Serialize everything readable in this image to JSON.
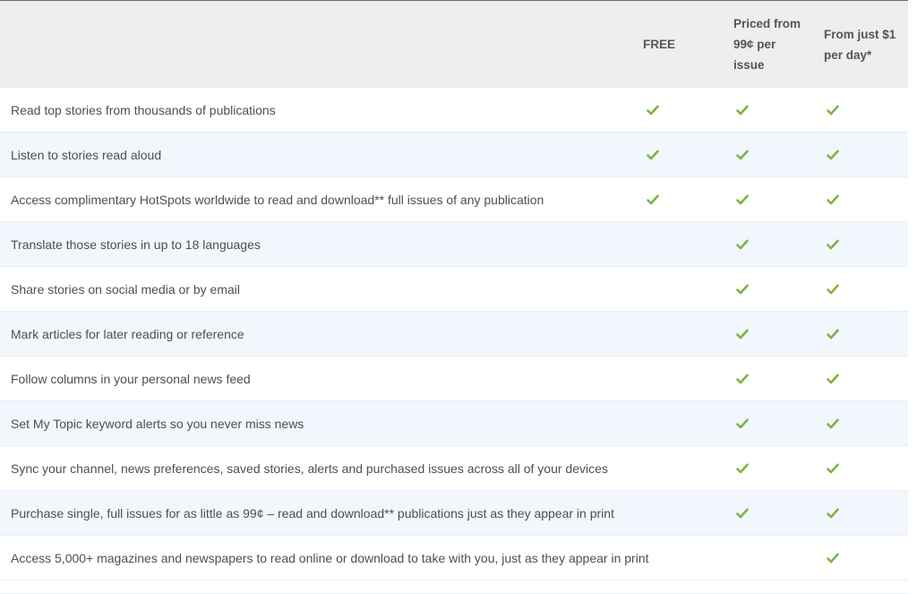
{
  "header": {
    "col_free": [
      "FREE"
    ],
    "col_priced": [
      "Priced from",
      "99¢ per",
      "issue"
    ],
    "col_day": [
      "From just $1",
      "per day*"
    ]
  },
  "colors": {
    "check": "#7cb342",
    "header_bg": "#eeeeee",
    "row_alt_bg": "#f1f7fc"
  },
  "rows": [
    {
      "feature": "Read top stories from thousands of publications",
      "free": true,
      "priced": true,
      "day": true
    },
    {
      "feature": "Listen to stories read aloud",
      "free": true,
      "priced": true,
      "day": true
    },
    {
      "feature": "Access complimentary HotSpots worldwide to read and download** full issues of any publication",
      "free": true,
      "priced": true,
      "day": true
    },
    {
      "feature": "Translate those stories in up to 18 languages",
      "free": false,
      "priced": true,
      "day": true
    },
    {
      "feature": "Share stories on social media or by email",
      "free": false,
      "priced": true,
      "day": true
    },
    {
      "feature": "Mark articles for later reading or reference",
      "free": false,
      "priced": true,
      "day": true
    },
    {
      "feature": "Follow columns in your personal news feed",
      "free": false,
      "priced": true,
      "day": true
    },
    {
      "feature": "Set My Topic keyword alerts so you never miss news",
      "free": false,
      "priced": true,
      "day": true
    },
    {
      "feature": "Sync your channel, news preferences, saved stories, alerts and purchased issues across all of your devices",
      "free": false,
      "priced": true,
      "day": true
    },
    {
      "feature": "Purchase single, full issues for as little as 99¢ – read and download** publications just as they appear in print",
      "free": false,
      "priced": true,
      "day": true
    },
    {
      "feature": "Access 5,000+ magazines and newspapers to read online or download to take with you, just as they appear in print",
      "free": false,
      "priced": false,
      "day": true
    }
  ]
}
